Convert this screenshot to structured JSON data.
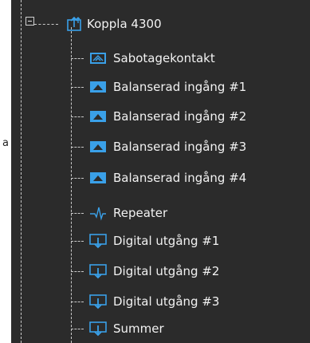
{
  "side_text": "a",
  "tree": {
    "root": {
      "label": "Koppla 4300",
      "icon": "device-upload-icon",
      "expanded": true
    },
    "items": [
      {
        "label": "Sabotagekontakt",
        "icon": "tamper-icon"
      },
      {
        "label": "Balanserad ingång #1",
        "icon": "balanced-input-icon"
      },
      {
        "label": "Balanserad ingång #2",
        "icon": "balanced-input-icon"
      },
      {
        "label": "Balanserad ingång #3",
        "icon": "balanced-input-icon"
      },
      {
        "label": "Balanserad ingång #4",
        "icon": "balanced-input-icon"
      },
      {
        "label": "Repeater",
        "icon": "pulse-icon"
      },
      {
        "label": "Digital utgång #1",
        "icon": "digital-output-icon"
      },
      {
        "label": "Digital utgång #2",
        "icon": "digital-output-icon"
      },
      {
        "label": "Digital utgång #3",
        "icon": "digital-output-icon"
      },
      {
        "label": "Summer",
        "icon": "digital-output-icon"
      }
    ]
  },
  "colors": {
    "panel_bg": "#2b2b2b",
    "text": "#f2f2f2",
    "icon_accent": "#3aa0e8",
    "connector": "#c9c9c9"
  }
}
